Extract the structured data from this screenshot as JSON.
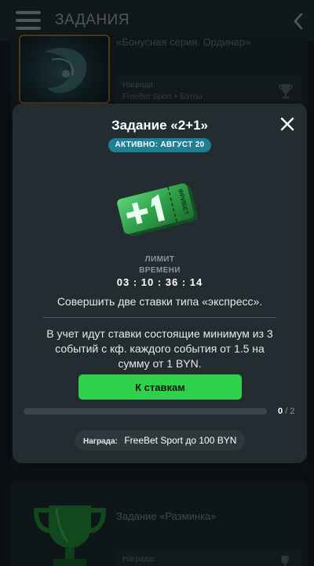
{
  "header": {
    "title": "ЗАДАНИЯ",
    "menu_icon": "hamburger-menu-icon",
    "back_icon": "chevron-left-icon"
  },
  "background_cards": [
    {
      "title": "«Бонусная серия. Ординар»",
      "reward_label": "Награда:",
      "reward_value": "FreeBet Sport + Бэтсы",
      "icon": "trophy-icon"
    },
    {
      "title": "Задание «Разминка»",
      "reward_label": "Награда:",
      "icon": "trophy-icon"
    }
  ],
  "modal": {
    "title": "Задание «2+1»",
    "status_badge": "АКТИВНО: АВГУСТ 20",
    "ticket_text": "ФРИБЕТ",
    "limit_label_line1": "ЛИМИТ",
    "limit_label_line2": "ВРЕМЕНИ",
    "timer": "03 : 10 : 36 : 14",
    "description": "Совершить две ставки типа «экспресс».",
    "conditions": "В учет идут ставки состоящие минимум из 3 событий с кф. каждого события от 1.5 на сумму от 1 BYN.",
    "cta_label": "К ставкам",
    "progress": {
      "current": "0",
      "separator": "/",
      "total": "2",
      "fraction": 0.0
    },
    "reward_label": "Награда:",
    "reward_value": "FreeBet Sport до 100 BYN"
  },
  "colors": {
    "accent_green": "#2ed149",
    "badge_blue": "#1f7f95",
    "modal_bg": "#232c31",
    "page_bg": "#0f1519"
  }
}
